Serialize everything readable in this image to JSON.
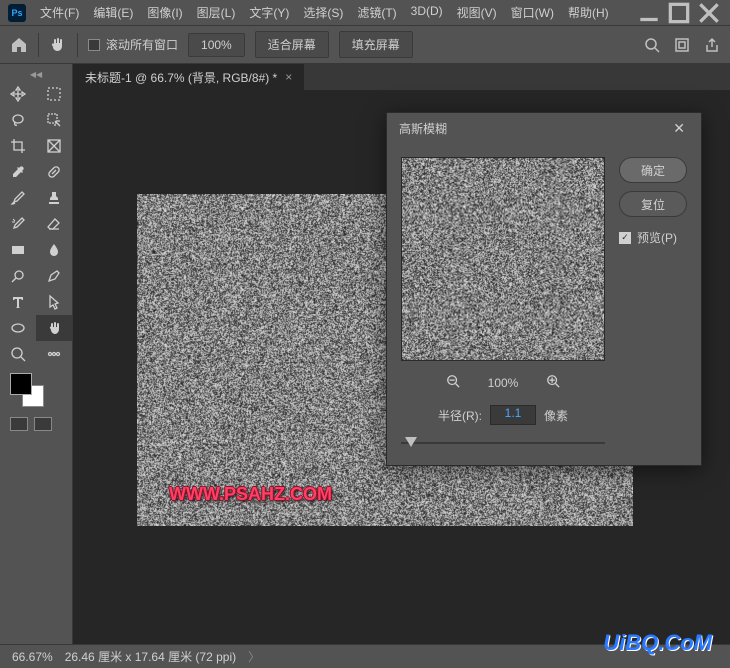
{
  "app": {
    "logo": "Ps"
  },
  "menu": [
    "文件(F)",
    "编辑(E)",
    "图像(I)",
    "图层(L)",
    "文字(Y)",
    "选择(S)",
    "滤镜(T)",
    "3D(D)",
    "视图(V)",
    "窗口(W)",
    "帮助(H)"
  ],
  "optbar": {
    "scroll_all": "滚动所有窗口",
    "zoom": "100%",
    "fit": "适合屏幕",
    "fill": "填充屏幕"
  },
  "tab": {
    "title": "未标题-1 @ 66.7% (背景, RGB/8#) *"
  },
  "watermark": "WWW.PSAHZ.COM",
  "uibq": "UiBQ.CoM",
  "dialog": {
    "title": "高斯模糊",
    "ok": "确定",
    "cancel": "复位",
    "preview": "预览(P)",
    "zoom": "100%",
    "radius_label": "半径(R):",
    "radius_value": "1.1",
    "unit": "像素"
  },
  "status": {
    "zoom": "66.67%",
    "dims": "26.46 厘米 x 17.64 厘米 (72 ppi)"
  }
}
